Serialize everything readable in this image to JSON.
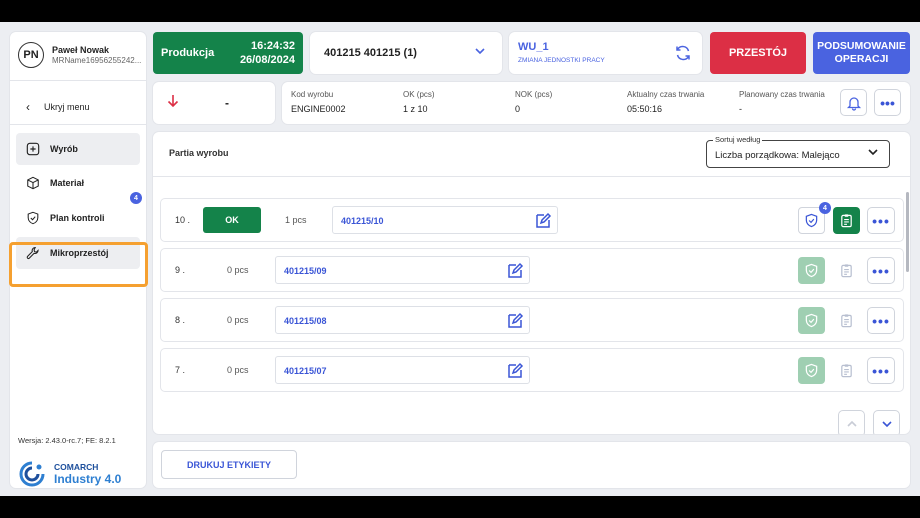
{
  "user": {
    "initials": "PN",
    "name": "Paweł Nowak",
    "sub": "MRName16956255242..."
  },
  "sidebar": {
    "hide_menu": "Ukryj menu",
    "items": [
      {
        "label": "Wyrób",
        "icon": "plus-circle-icon"
      },
      {
        "label": "Materiał",
        "icon": "cube-icon"
      },
      {
        "label": "Plan kontroli",
        "icon": "shield-check-icon",
        "badge": "4"
      },
      {
        "label": "Mikroprzestój",
        "icon": "wrench-icon"
      }
    ],
    "version": "Wersja: 2.43.0-rc.7; FE: 8.2.1",
    "logo_line1": "COMARCH",
    "logo_line2": "Industry 4.0"
  },
  "topbar": {
    "status_label": "Produkcja",
    "time": "16:24:32",
    "date": "26/08/2024",
    "order": "401215 401215  (1)",
    "wu_name": "WU_1",
    "wu_sub": "ZMIANA JEDNOSTKI PRACY",
    "stop_label": "PRZESTÓJ",
    "summary_label": "PODSUMOWANIE OPERACJI"
  },
  "info": {
    "direction_value": "-",
    "columns": [
      {
        "label": "Kod wyrobu",
        "value": "ENGINE0002"
      },
      {
        "label": "OK (pcs)",
        "value": "1 z 10"
      },
      {
        "label": "NOK (pcs)",
        "value": "0"
      },
      {
        "label": "Aktualny czas trwania",
        "value": "05:50:16"
      },
      {
        "label": "Planowany czas trwania",
        "value": "-"
      }
    ]
  },
  "main": {
    "title": "Partia wyrobu",
    "sort_label": "Sortuj według",
    "sort_value": "Liczba porządkowa: Malejąco",
    "rows": [
      {
        "num": "10 .",
        "ok": "OK",
        "pcs": "1  pcs",
        "batch": "401215/10",
        "badge": "4"
      },
      {
        "num": "9 .",
        "pcs": "0  pcs",
        "batch": "401215/09"
      },
      {
        "num": "8 .",
        "pcs": "0  pcs",
        "batch": "401215/08"
      },
      {
        "num": "7 .",
        "pcs": "0  pcs",
        "batch": "401215/07"
      }
    ],
    "more_label": "•••"
  },
  "bottom": {
    "print_label": "DRUKUJ ETYKIETY"
  },
  "colors": {
    "green": "#14834a",
    "red": "#dc2f45",
    "blue": "#4a63e0",
    "highlight": "#f5a030"
  }
}
